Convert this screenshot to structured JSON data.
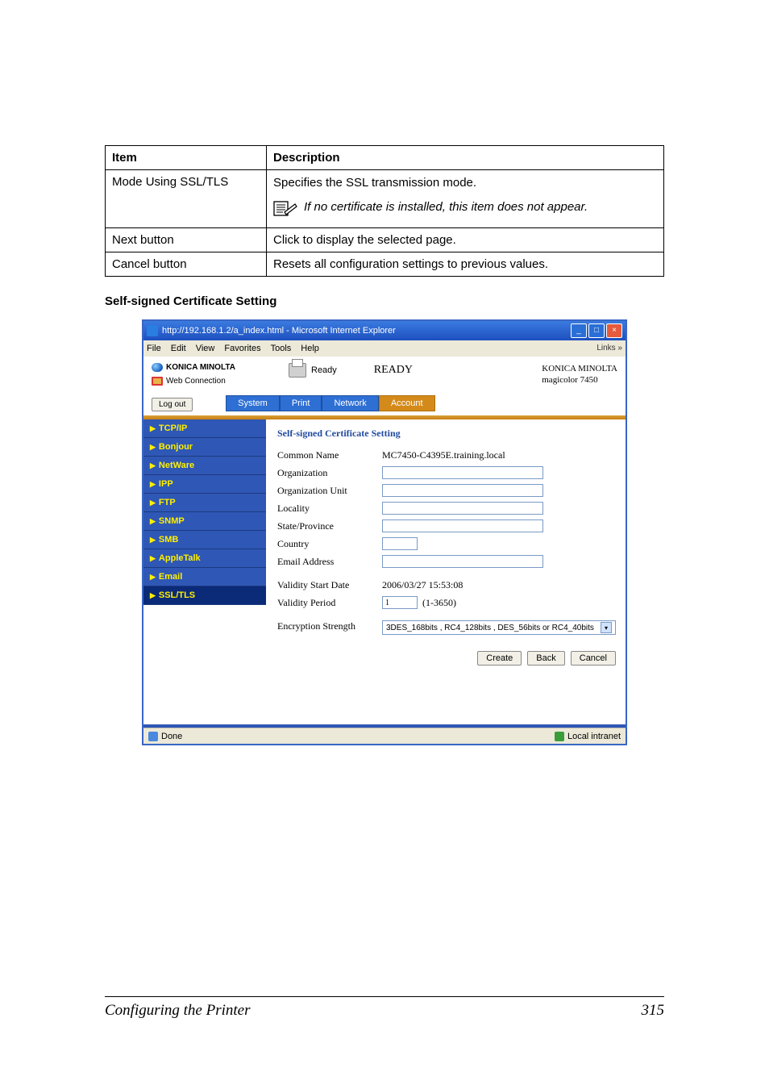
{
  "table": {
    "headers": {
      "item": "Item",
      "desc": "Description"
    },
    "rows": [
      {
        "item": "Mode Using SSL/TLS",
        "desc": "Specifies the SSL transmission mode.",
        "note": "If no certificate is installed, this item does not appear."
      },
      {
        "item": "Next button",
        "desc": "Click to display the selected page."
      },
      {
        "item": "Cancel button",
        "desc": "Resets all configuration settings to previous values."
      }
    ]
  },
  "section_title": "Self-signed Certificate Setting",
  "window": {
    "title": "http://192.168.1.2/a_index.html - Microsoft Internet Explorer",
    "menus": [
      "File",
      "Edit",
      "View",
      "Favorites",
      "Tools",
      "Help"
    ],
    "links_label": "Links »",
    "win_min": "_",
    "win_max": "□",
    "win_close": "×",
    "brand": "KONICA MINOLTA",
    "webconn": "Web Connection",
    "ready_small": "Ready",
    "ready_big": "READY",
    "right1": "KONICA MINOLTA",
    "right2": "magicolor 7450",
    "logout": "Log out",
    "tabs": [
      "System",
      "Print",
      "Network",
      "Account"
    ],
    "side": [
      "TCP/IP",
      "Bonjour",
      "NetWare",
      "IPP",
      "FTP",
      "SNMP",
      "SMB",
      "AppleTalk",
      "Email",
      "SSL/TLS"
    ],
    "form": {
      "title": "Self-signed Certificate Setting",
      "common_name_lbl": "Common Name",
      "common_name_val": "MC7450-C4395E.training.local",
      "organization_lbl": "Organization",
      "org_unit_lbl": "Organization Unit",
      "locality_lbl": "Locality",
      "state_lbl": "State/Province",
      "country_lbl": "Country",
      "email_lbl": "Email Address",
      "start_lbl": "Validity Start Date",
      "start_val": "2006/03/27 15:53:08",
      "period_lbl": "Validity Period",
      "period_val": "1",
      "period_range": "(1-3650)",
      "enc_lbl": "Encryption Strength",
      "enc_val": "3DES_168bits , RC4_128bits , DES_56bits or RC4_40bits",
      "create": "Create",
      "back": "Back",
      "cancel": "Cancel"
    },
    "status_done": "Done",
    "status_net": "Local intranet"
  },
  "footer": {
    "title": "Configuring the Printer",
    "page": "315"
  }
}
